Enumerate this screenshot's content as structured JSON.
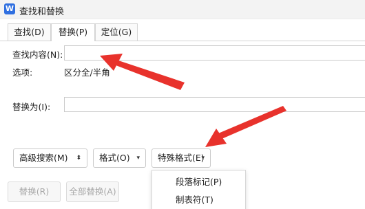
{
  "window": {
    "title": "查找和替换",
    "app_icon": "W"
  },
  "tabs": [
    {
      "label": "查找(D)"
    },
    {
      "label": "替换(P)",
      "active": true
    },
    {
      "label": "定位(G)"
    }
  ],
  "find": {
    "label": "查找内容(N):",
    "value": ""
  },
  "options": {
    "label": "选项:",
    "value": "区分全/半角"
  },
  "replace": {
    "label": "替换为(I):",
    "value": ""
  },
  "buttons": {
    "advanced_search": "高级搜索(M)",
    "format": "格式(O)",
    "special_format": "特殊格式(E)",
    "replace": "替换(R)",
    "replace_all": "全部替换(A)"
  },
  "dropdown_items": [
    "段落标记(P)",
    "制表符(T)"
  ],
  "icons": {
    "dropdown": "▾",
    "spinner": "⬍"
  },
  "colors": {
    "accent": "#2f6fe0",
    "annotation_arrow": "#e8322c"
  }
}
